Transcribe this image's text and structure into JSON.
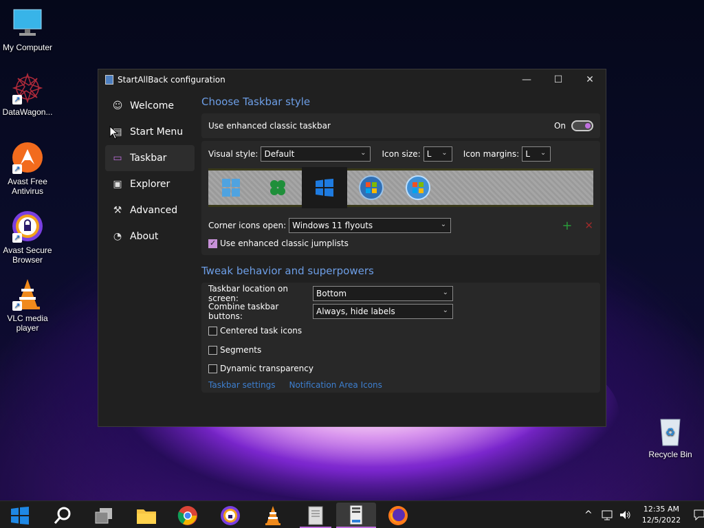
{
  "desktop": {
    "icons": [
      {
        "label": "My Computer",
        "icon": "monitor-icon"
      },
      {
        "label": "DataWagon...",
        "icon": "datawagon-icon"
      },
      {
        "label": "Avast Free\nAntivirus",
        "icon": "avast-antivirus-icon"
      },
      {
        "label": "Avast Secure\nBrowser",
        "icon": "avast-browser-icon"
      },
      {
        "label": "VLC media\nplayer",
        "icon": "vlc-icon"
      },
      {
        "label": "Recycle Bin",
        "icon": "recycle-bin-icon"
      }
    ]
  },
  "window": {
    "title": "StartAllBack configuration",
    "controls": {
      "minimize": "—",
      "maximize": "☐",
      "close": "✕"
    }
  },
  "sidebar": {
    "items": [
      {
        "label": "Welcome",
        "icon": "smile-icon"
      },
      {
        "label": "Start Menu",
        "icon": "start-menu-icon"
      },
      {
        "label": "Taskbar",
        "icon": "taskbar-icon",
        "active": true
      },
      {
        "label": "Explorer",
        "icon": "explorer-icon"
      },
      {
        "label": "Advanced",
        "icon": "wrench-icon"
      },
      {
        "label": "About",
        "icon": "gauge-icon"
      }
    ]
  },
  "taskbar_style": {
    "section_title": "Choose Taskbar style",
    "enhanced_label": "Use enhanced classic taskbar",
    "enhanced_state": "On",
    "visual_style_label": "Visual style:",
    "visual_style_value": "Default",
    "icon_size_label": "Icon size:",
    "icon_size_value": "L",
    "icon_margins_label": "Icon margins:",
    "icon_margins_value": "L",
    "corner_icons_label": "Corner icons open:",
    "corner_icons_value": "Windows 11 flyouts",
    "add_symbol": "+",
    "remove_symbol": "✕",
    "jumplists_label": "Use enhanced classic jumplists",
    "jumplists_checked": true
  },
  "tweak": {
    "section_title": "Tweak behavior and superpowers",
    "location_label": "Taskbar location on screen:",
    "location_value": "Bottom",
    "combine_label": "Combine taskbar buttons:",
    "combine_value": "Always, hide labels",
    "centered_label": "Centered task icons",
    "segments_label": "Segments",
    "dynamic_label": "Dynamic transparency",
    "link_taskbar_settings": "Taskbar settings",
    "link_notification": "Notification Area Icons"
  },
  "taskbar": {
    "apps": [
      "windows-start-icon",
      "search-icon",
      "task-view-icon",
      "file-explorer-icon",
      "chrome-icon",
      "avast-browser-icon",
      "vlc-icon",
      "documents-icon",
      "startallback-icon",
      "firefox-icon"
    ],
    "time": "12:35 AM",
    "date": "12/5/2022",
    "tray_chevron": "^"
  },
  "colors": {
    "accent": "#c070e0",
    "section_title": "#6d9ee6",
    "link": "#3d7fd0",
    "window_bg": "#202020",
    "card_bg": "#282828"
  }
}
